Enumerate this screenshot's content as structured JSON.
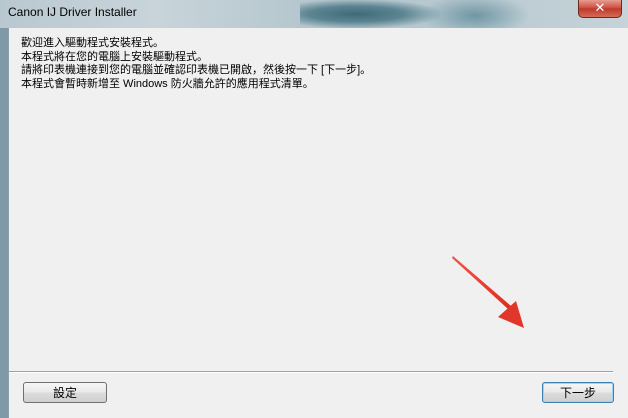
{
  "window": {
    "title": "Canon IJ Driver Installer",
    "close_glyph": "✕"
  },
  "message": {
    "lines": [
      "歡迎進入驅動程式安裝程式。",
      "本程式將在您的電腦上安裝驅動程式。",
      "請將印表機連接到您的電腦並確認印表機已開啟，然後按一下 [下一步]。",
      "本程式會暫時新增至 Windows 防火牆允許的應用程式清單。"
    ]
  },
  "buttons": {
    "settings_label": "設定",
    "next_label": "下一步"
  },
  "annotation": {
    "arrow_color": "#e8392f",
    "icon": "red-arrow-icon"
  }
}
